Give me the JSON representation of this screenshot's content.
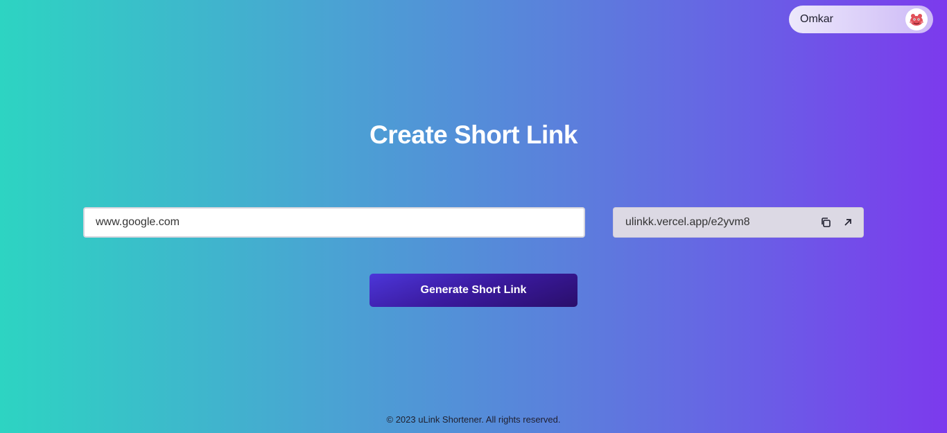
{
  "user": {
    "name": "Omkar",
    "avatar_icon": "mascot-avatar-icon"
  },
  "main": {
    "title": "Create Short Link",
    "long_url_value": "www.google.com",
    "short_url": "ulinkk.vercel.app/e2yvm8",
    "copy_icon": "copy-icon",
    "open_icon": "external-link-icon",
    "generate_label": "Generate Short Link"
  },
  "footer": {
    "text": "© 2023 uLink Shortener. All rights reserved."
  },
  "colors": {
    "gradient_start": "#2dd4c2",
    "gradient_end": "#7c3aed",
    "button_start": "#4c36d9",
    "button_end": "#2a0e6b"
  }
}
